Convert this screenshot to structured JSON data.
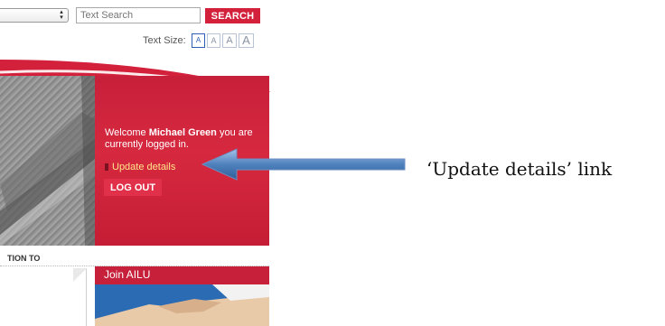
{
  "header": {
    "search_placeholder": "Text Search",
    "search_button": "SEARCH",
    "text_size_label": "Text Size:",
    "text_size_options": [
      "A",
      "A",
      "A",
      "A"
    ]
  },
  "hero": {
    "welcome_prefix": "Welcome ",
    "user_name": "Michael Green",
    "welcome_suffix": " you are currently logged in.",
    "update_link": "Update details",
    "logout_button": "LOG OUT"
  },
  "annotation": {
    "text": "‘Update details’ link"
  },
  "bottom": {
    "tab_label": "TION TO",
    "join_title": "Join AILU"
  },
  "colors": {
    "brand_red": "#d3203b",
    "link_yellow": "#ffe58a",
    "arrow_blue": "#4f81bd"
  }
}
